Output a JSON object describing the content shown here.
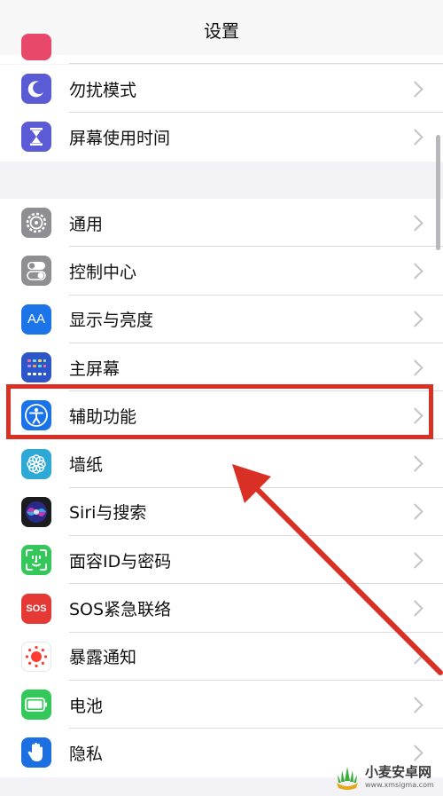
{
  "nav": {
    "title": "设置"
  },
  "groups": [
    {
      "items": [
        {
          "label": "勿扰模式",
          "icon": "moon-icon",
          "color": "#5b5bd6"
        },
        {
          "label": "屏幕使用时间",
          "icon": "hourglass-icon",
          "color": "#5b5bd6"
        }
      ]
    },
    {
      "items": [
        {
          "label": "通用",
          "icon": "gear-icon",
          "color": "#8e8e93"
        },
        {
          "label": "控制中心",
          "icon": "toggles-icon",
          "color": "#8e8e93"
        },
        {
          "label": "显示与亮度",
          "icon": "text-size-icon",
          "color": "#1b74e8",
          "icon_text": "AA"
        },
        {
          "label": "主屏幕",
          "icon": "home-grid-icon",
          "color": "#2c56c9"
        },
        {
          "label": "辅助功能",
          "icon": "accessibility-icon",
          "color": "#1a73e8"
        },
        {
          "label": "墙纸",
          "icon": "flower-icon",
          "color": "#2ea8d5"
        },
        {
          "label": "Siri与搜索",
          "icon": "siri-icon",
          "color": "#1c1c1e"
        },
        {
          "label": "面容ID与密码",
          "icon": "face-id-icon",
          "color": "#34c759"
        },
        {
          "label": "SOS紧急联络",
          "icon": "sos-icon",
          "color": "#e53935",
          "icon_text": "SOS"
        },
        {
          "label": "暴露通知",
          "icon": "exposure-icon",
          "color": "#ffffff"
        },
        {
          "label": "电池",
          "icon": "battery-icon",
          "color": "#34c759"
        },
        {
          "label": "隐私",
          "icon": "hand-icon",
          "color": "#1b6fe0"
        }
      ]
    }
  ],
  "watermark": {
    "main": "小麦安卓网",
    "sub": "www.xmsigma.com"
  }
}
